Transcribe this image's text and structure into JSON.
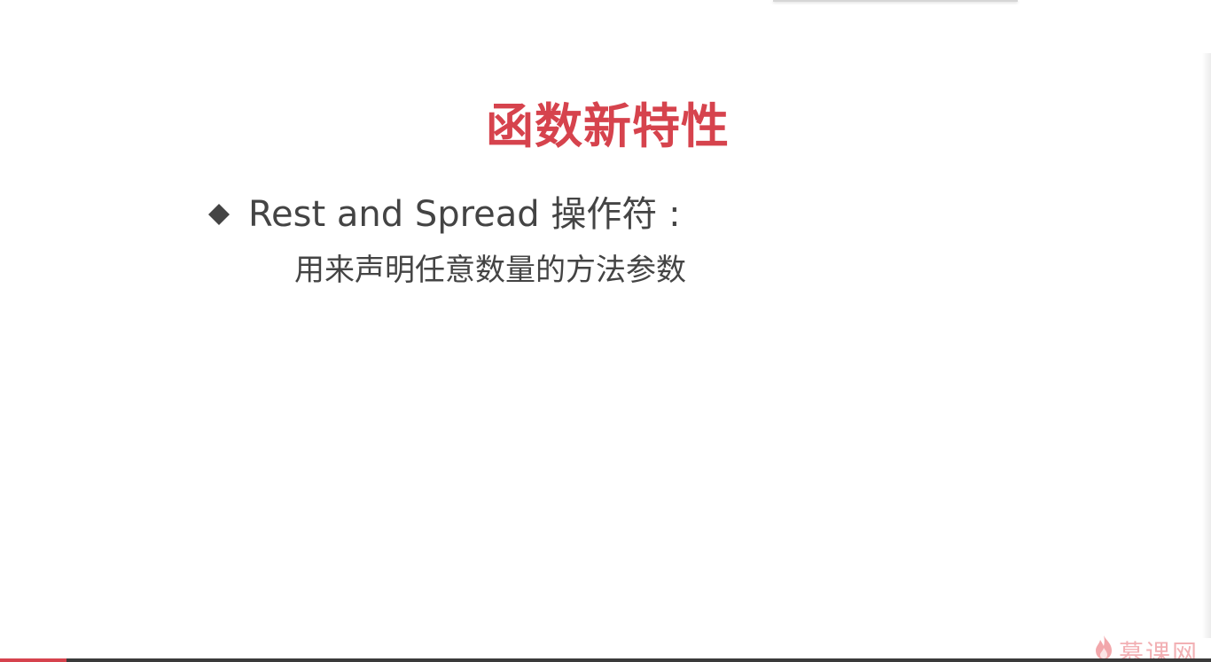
{
  "slide": {
    "title": "函数新特性",
    "bullet": {
      "text": "Rest and Spread 操作符 :",
      "subtext": "用来声明任意数量的方法参数"
    }
  },
  "player": {
    "progress_fraction": 0.055,
    "accent_color": "#d6434d"
  },
  "logo": {
    "text": "慕课网",
    "icon": "flame-icon",
    "color": "#f2b0b4"
  },
  "icons": {
    "bullet": "diamond-bullet-icon"
  },
  "colors": {
    "title": "#d6434d",
    "body_text": "#444444",
    "background": "#ffffff"
  }
}
